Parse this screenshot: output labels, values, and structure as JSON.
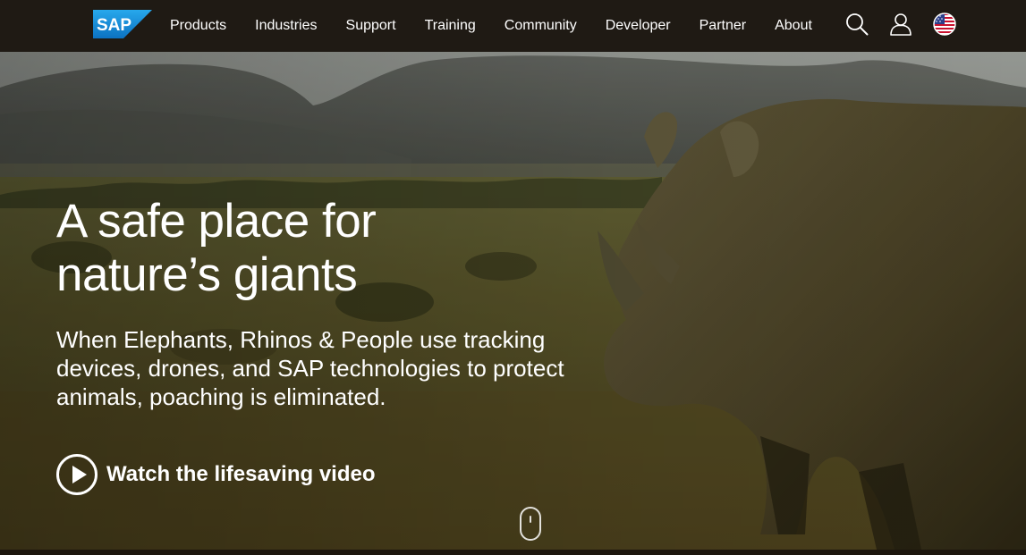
{
  "nav": {
    "logo_text": "SAP",
    "items": [
      {
        "label": "Products"
      },
      {
        "label": "Industries"
      },
      {
        "label": "Support"
      },
      {
        "label": "Training"
      },
      {
        "label": "Community"
      },
      {
        "label": "Developer"
      },
      {
        "label": "Partner"
      },
      {
        "label": "About"
      }
    ],
    "icons": [
      "search-icon",
      "user-icon",
      "us-flag-icon"
    ]
  },
  "hero": {
    "title": "A safe place for nature’s giants",
    "subtitle": "When Elephants, Rhinos & People use tracking devices, drones, and SAP technologies to protect animals, poaching is eliminated.",
    "cta_label": "Watch the lifesaving video",
    "cta_icon": "play-circle-icon",
    "scroll_icon": "scroll-mouse-icon"
  },
  "colors": {
    "nav_bg": "#1f1a14",
    "brand_blue": "#1a8fd8",
    "text": "#ffffff"
  }
}
